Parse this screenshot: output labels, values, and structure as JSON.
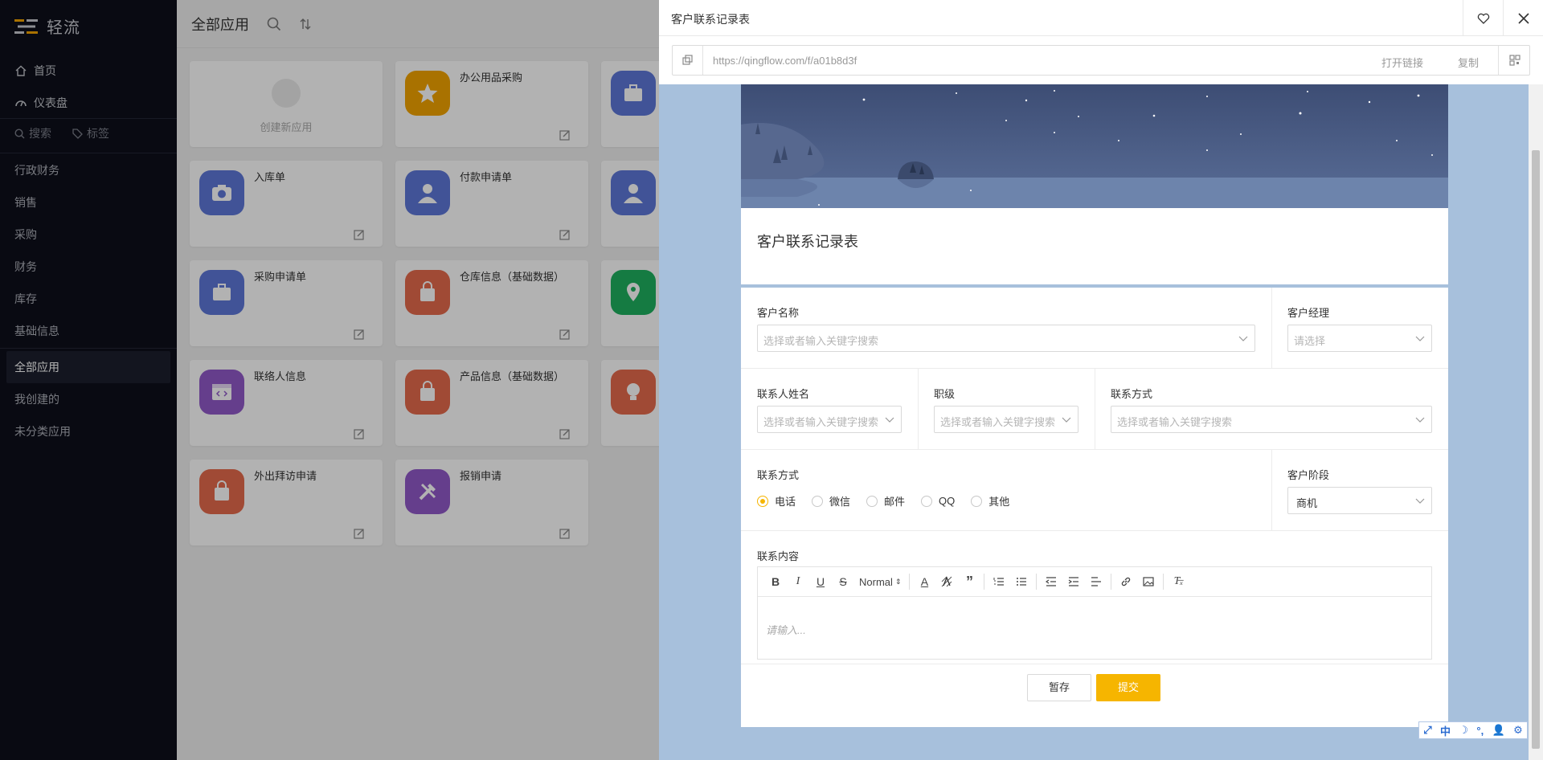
{
  "app": {
    "name": "轻流"
  },
  "nav": {
    "home": "首页",
    "dashboard": "仪表盘",
    "search": "搜索",
    "tags": "标签"
  },
  "categories": [
    "行政财务",
    "销售",
    "采购",
    "财务",
    "库存",
    "基础信息"
  ],
  "categories2": [
    "全部应用",
    "我创建的",
    "未分类应用"
  ],
  "main": {
    "title": "全部应用",
    "new_app": "创建新应用",
    "cards": [
      {
        "name": "办公用品采购",
        "icon": "star-icon",
        "color": "#f2a400"
      },
      {
        "name": "入库单",
        "icon": "camera-icon",
        "color": "#5e78d8"
      },
      {
        "name": "付款申请单",
        "icon": "person-icon",
        "color": "#5e78d8"
      },
      {
        "name": "采购申请单",
        "icon": "briefcase-icon",
        "color": "#5e78d8"
      },
      {
        "name": "仓库信息（基础数据）",
        "icon": "bag-icon",
        "color": "#e56b4d"
      },
      {
        "name": "联络人信息",
        "icon": "code-window-icon",
        "color": "#9159c9"
      },
      {
        "name": "产品信息（基础数据）",
        "icon": "bag-icon",
        "color": "#e56b4d"
      },
      {
        "name": "外出拜访申请",
        "icon": "bag-icon",
        "color": "#e56b4d"
      },
      {
        "name": "报销申请",
        "icon": "tools-icon",
        "color": "#9159c9"
      }
    ]
  },
  "drawer": {
    "title": "客户联系记录表",
    "url": "https://qingflow.com/f/a01b8d3f",
    "open_link": "打开链接",
    "copy": "复制"
  },
  "form": {
    "title": "客户联系记录表",
    "customer_name": {
      "label": "客户名称",
      "placeholder": "选择或者输入关键字搜索"
    },
    "manager": {
      "label": "客户经理",
      "placeholder": "请选择"
    },
    "contact_name": {
      "label": "联系人姓名",
      "placeholder": "选择或者输入关键字搜索"
    },
    "rank": {
      "label": "职级",
      "placeholder": "选择或者输入关键字搜索"
    },
    "contact_info": {
      "label": "联系方式",
      "placeholder": "选择或者输入关键字搜索"
    },
    "method": {
      "label": "联系方式",
      "options": [
        "电话",
        "微信",
        "邮件",
        "QQ",
        "其他"
      ],
      "selected": "电话"
    },
    "stage": {
      "label": "客户阶段",
      "value": "商机"
    },
    "content": {
      "label": "联系内容",
      "placeholder": "请输入...",
      "format": "Normal"
    },
    "save": "暂存",
    "submit": "提交"
  },
  "ime": {
    "lang": "中"
  },
  "colors": {
    "accent": "#f6b500",
    "sidebar": "#0d0f1a",
    "drawer_bg": "#a7c0dc"
  }
}
